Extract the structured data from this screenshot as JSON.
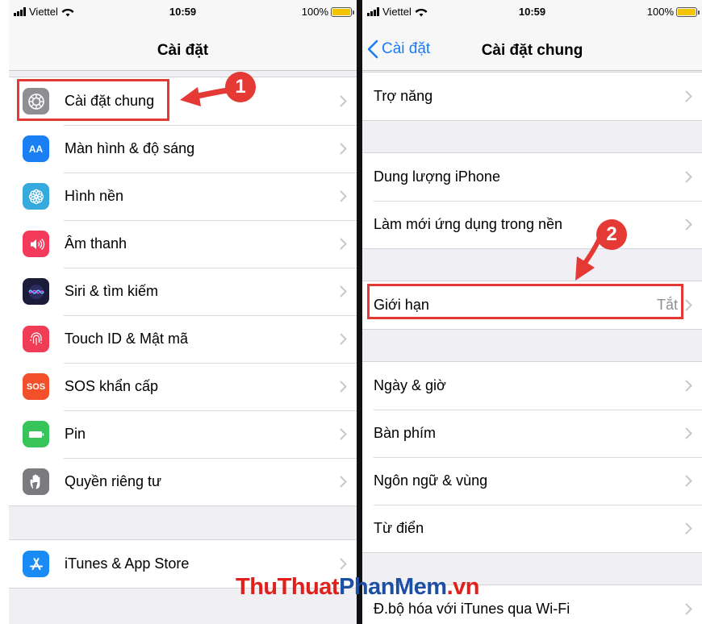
{
  "left_screen": {
    "status": {
      "carrier": "Viettel",
      "time": "10:59",
      "battery": "100%"
    },
    "nav_title": "Cài đặt",
    "groups": [
      [
        {
          "label": "Cài đặt chung",
          "icon": "gear-icon"
        },
        {
          "label": "Màn hình & độ sáng",
          "icon": "display-brightness-icon",
          "glyph": "AA"
        },
        {
          "label": "Hình nền",
          "icon": "wallpaper-flower-icon"
        },
        {
          "label": "Âm thanh",
          "icon": "speaker-icon"
        },
        {
          "label": "Siri & tìm kiếm",
          "icon": "siri-icon"
        },
        {
          "label": "Touch ID & Mật mã",
          "icon": "fingerprint-icon"
        },
        {
          "label": "SOS khẩn cấp",
          "icon": "sos-icon",
          "glyph": "SOS"
        },
        {
          "label": "Pin",
          "icon": "battery-icon"
        },
        {
          "label": "Quyền riêng tư",
          "icon": "hand-icon"
        }
      ],
      [
        {
          "label": "iTunes & App Store",
          "icon": "app-store-icon"
        }
      ]
    ],
    "step_badge": "1"
  },
  "right_screen": {
    "status": {
      "carrier": "Viettel",
      "time": "10:59",
      "battery": "100%"
    },
    "back_label": "Cài đặt",
    "nav_title": "Cài đặt chung",
    "groups": [
      [
        {
          "label": "Trợ năng"
        }
      ],
      [
        {
          "label": "Dung lượng iPhone"
        },
        {
          "label": "Làm mới ứng dụng trong nền"
        }
      ],
      [
        {
          "label": "Giới hạn",
          "value": "Tắt"
        }
      ],
      [
        {
          "label": "Ngày & giờ"
        },
        {
          "label": "Bàn phím"
        },
        {
          "label": "Ngôn ngữ & vùng"
        },
        {
          "label": "Từ điển"
        }
      ],
      [
        {
          "label": "Đ.bộ hóa với iTunes qua Wi-Fi"
        }
      ]
    ],
    "step_badge": "2"
  },
  "watermark": {
    "part1": "ThuThuat",
    "part2": "PhanMem",
    "part3": ".vn"
  },
  "colors": {
    "ios_blue": "#1c7cf6",
    "highlight_red": "#e53935",
    "group_bg": "#efeff4"
  }
}
